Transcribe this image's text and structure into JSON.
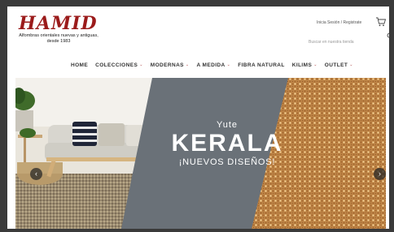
{
  "logo": {
    "wordmark": "HAMID",
    "tagline_line1": "Alfombras orientales nuevas y antiguas,",
    "tagline_line2": "desde 1983"
  },
  "header": {
    "login_link": "Inicia Sesión / Registrate",
    "search_placeholder": "Buscar en nuestra tienda"
  },
  "nav": {
    "items": [
      {
        "label": "HOME",
        "has_dropdown": false
      },
      {
        "label": "COLECCIONES",
        "has_dropdown": true
      },
      {
        "label": "MODERNAS",
        "has_dropdown": true
      },
      {
        "label": "A MEDIDA",
        "has_dropdown": true
      },
      {
        "label": "FIBRA NATURAL",
        "has_dropdown": false
      },
      {
        "label": "KILIMS",
        "has_dropdown": true
      },
      {
        "label": "OUTLET",
        "has_dropdown": true
      }
    ],
    "dropdown_glyph": "⌄"
  },
  "hero": {
    "kicker": "Yute",
    "title": "KERALA",
    "subtitle": "¡NUEVOS DISEÑOS!",
    "prev_glyph": "‹",
    "next_glyph": "›"
  },
  "colors": {
    "brand": "#9b1b1b",
    "overlay": "#6a7178",
    "nav_text": "#333333"
  },
  "icons": [
    "cart-icon",
    "search-icon",
    "chevron-down-icon",
    "arrow-left-icon",
    "arrow-right-icon"
  ]
}
